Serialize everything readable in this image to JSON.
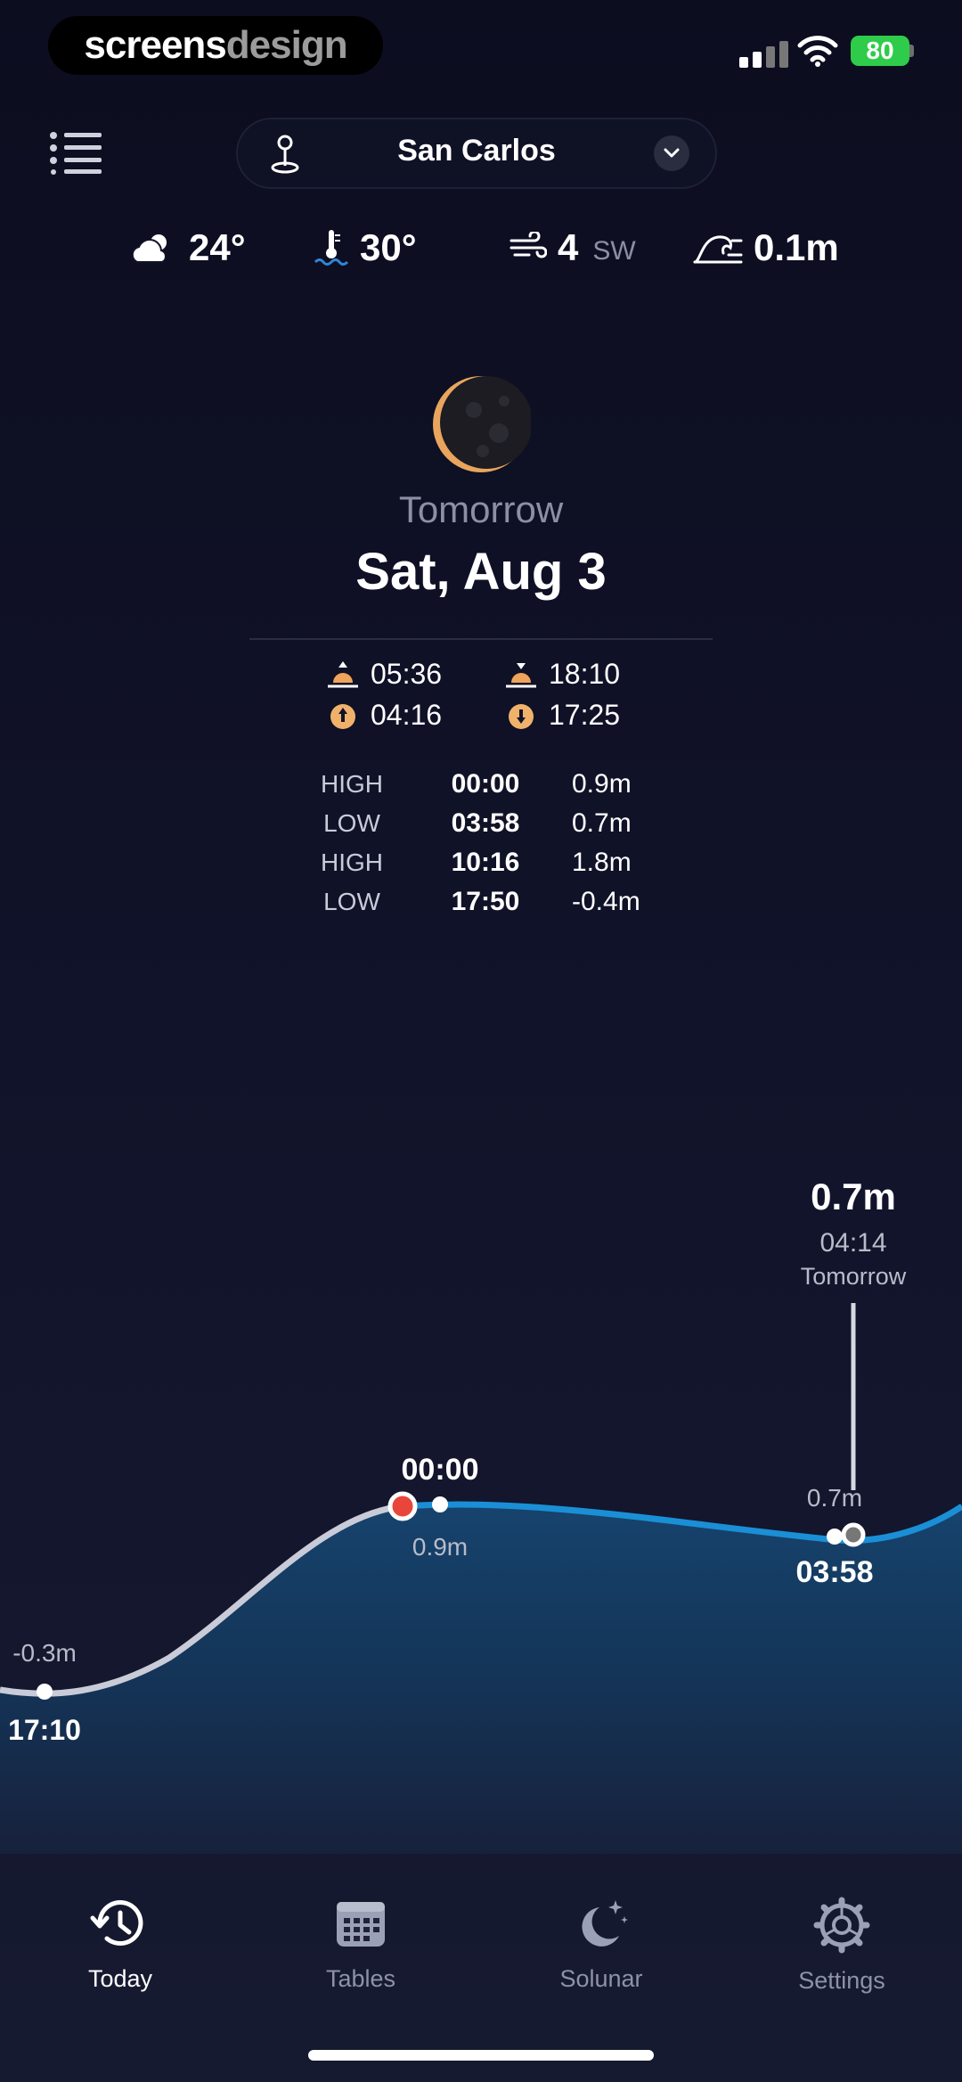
{
  "status_bar": {
    "brand_a": "screens",
    "brand_b": "design",
    "battery": "80"
  },
  "header": {
    "location": "San Carlos"
  },
  "conditions": {
    "air_temp": "24°",
    "water_temp": "30°",
    "wind_speed": "4",
    "wind_dir": "SW",
    "wave": "0.1m"
  },
  "day": {
    "relative": "Tomorrow",
    "date": "Sat, Aug 3",
    "sunrise": "05:36",
    "sunset": "18:10",
    "moonrise": "04:16",
    "moonset": "17:25"
  },
  "tides": [
    {
      "type": "HIGH",
      "time": "00:00",
      "height": "0.9m"
    },
    {
      "type": "LOW",
      "time": "03:58",
      "height": "0.7m"
    },
    {
      "type": "HIGH",
      "time": "10:16",
      "height": "1.8m"
    },
    {
      "type": "LOW",
      "time": "17:50",
      "height": "-0.4m"
    }
  ],
  "chart": {
    "cursor_height": "0.7m",
    "cursor_time": "04:14",
    "cursor_day": "Tomorrow",
    "point_left_height": "-0.3m",
    "point_left_time": "17:10",
    "point_mid_time": "00:00",
    "point_mid_height": "0.9m",
    "point_right_height": "0.7m",
    "point_right_time": "03:58",
    "colors": {
      "past": "#c9cbd8",
      "future": "#1a8fd6",
      "now": "#e8463a"
    }
  },
  "chart_data": {
    "type": "area",
    "x": [
      "17:10",
      "00:00",
      "03:58"
    ],
    "values": [
      -0.3,
      0.9,
      0.7
    ],
    "current": {
      "time": "04:14",
      "value": 0.7
    }
  },
  "tabs": [
    {
      "label": "Today",
      "icon": "clock-refresh-icon",
      "active": true
    },
    {
      "label": "Tables",
      "icon": "calendar-grid-icon",
      "active": false
    },
    {
      "label": "Solunar",
      "icon": "moon-stars-icon",
      "active": false
    },
    {
      "label": "Settings",
      "icon": "gear-icon",
      "active": false
    }
  ]
}
